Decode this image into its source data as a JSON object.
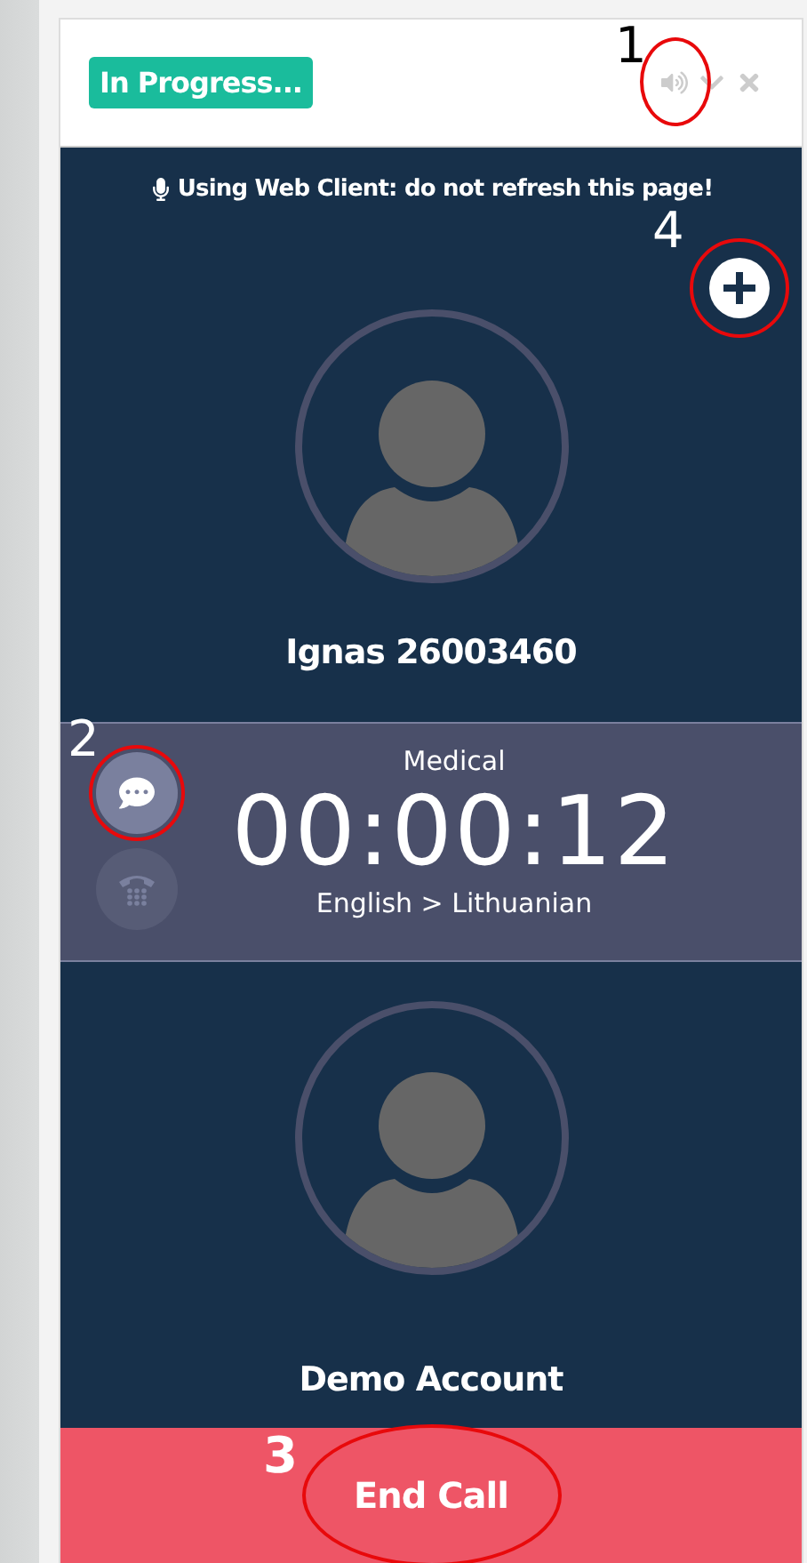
{
  "header": {
    "status": "In Progress...",
    "controls": [
      {
        "kind": "speaker",
        "annotation": "1"
      },
      {
        "kind": "collapse"
      },
      {
        "kind": "close"
      }
    ]
  },
  "notice": "Using Web Client: do not refresh this page!",
  "add_button": {
    "annotation": "4"
  },
  "caller": {
    "name": "Ignas 26003460"
  },
  "call_info": {
    "side_buttons": [
      {
        "kind": "chat",
        "disabled": false,
        "annotation": "2"
      },
      {
        "kind": "dialpad",
        "disabled": true
      }
    ],
    "category": "Medical",
    "timer": "00:00:12",
    "languages": "English > Lithuanian"
  },
  "callee": {
    "name": "Demo Account"
  },
  "end_button": {
    "label": "End Call",
    "annotation": "3"
  }
}
